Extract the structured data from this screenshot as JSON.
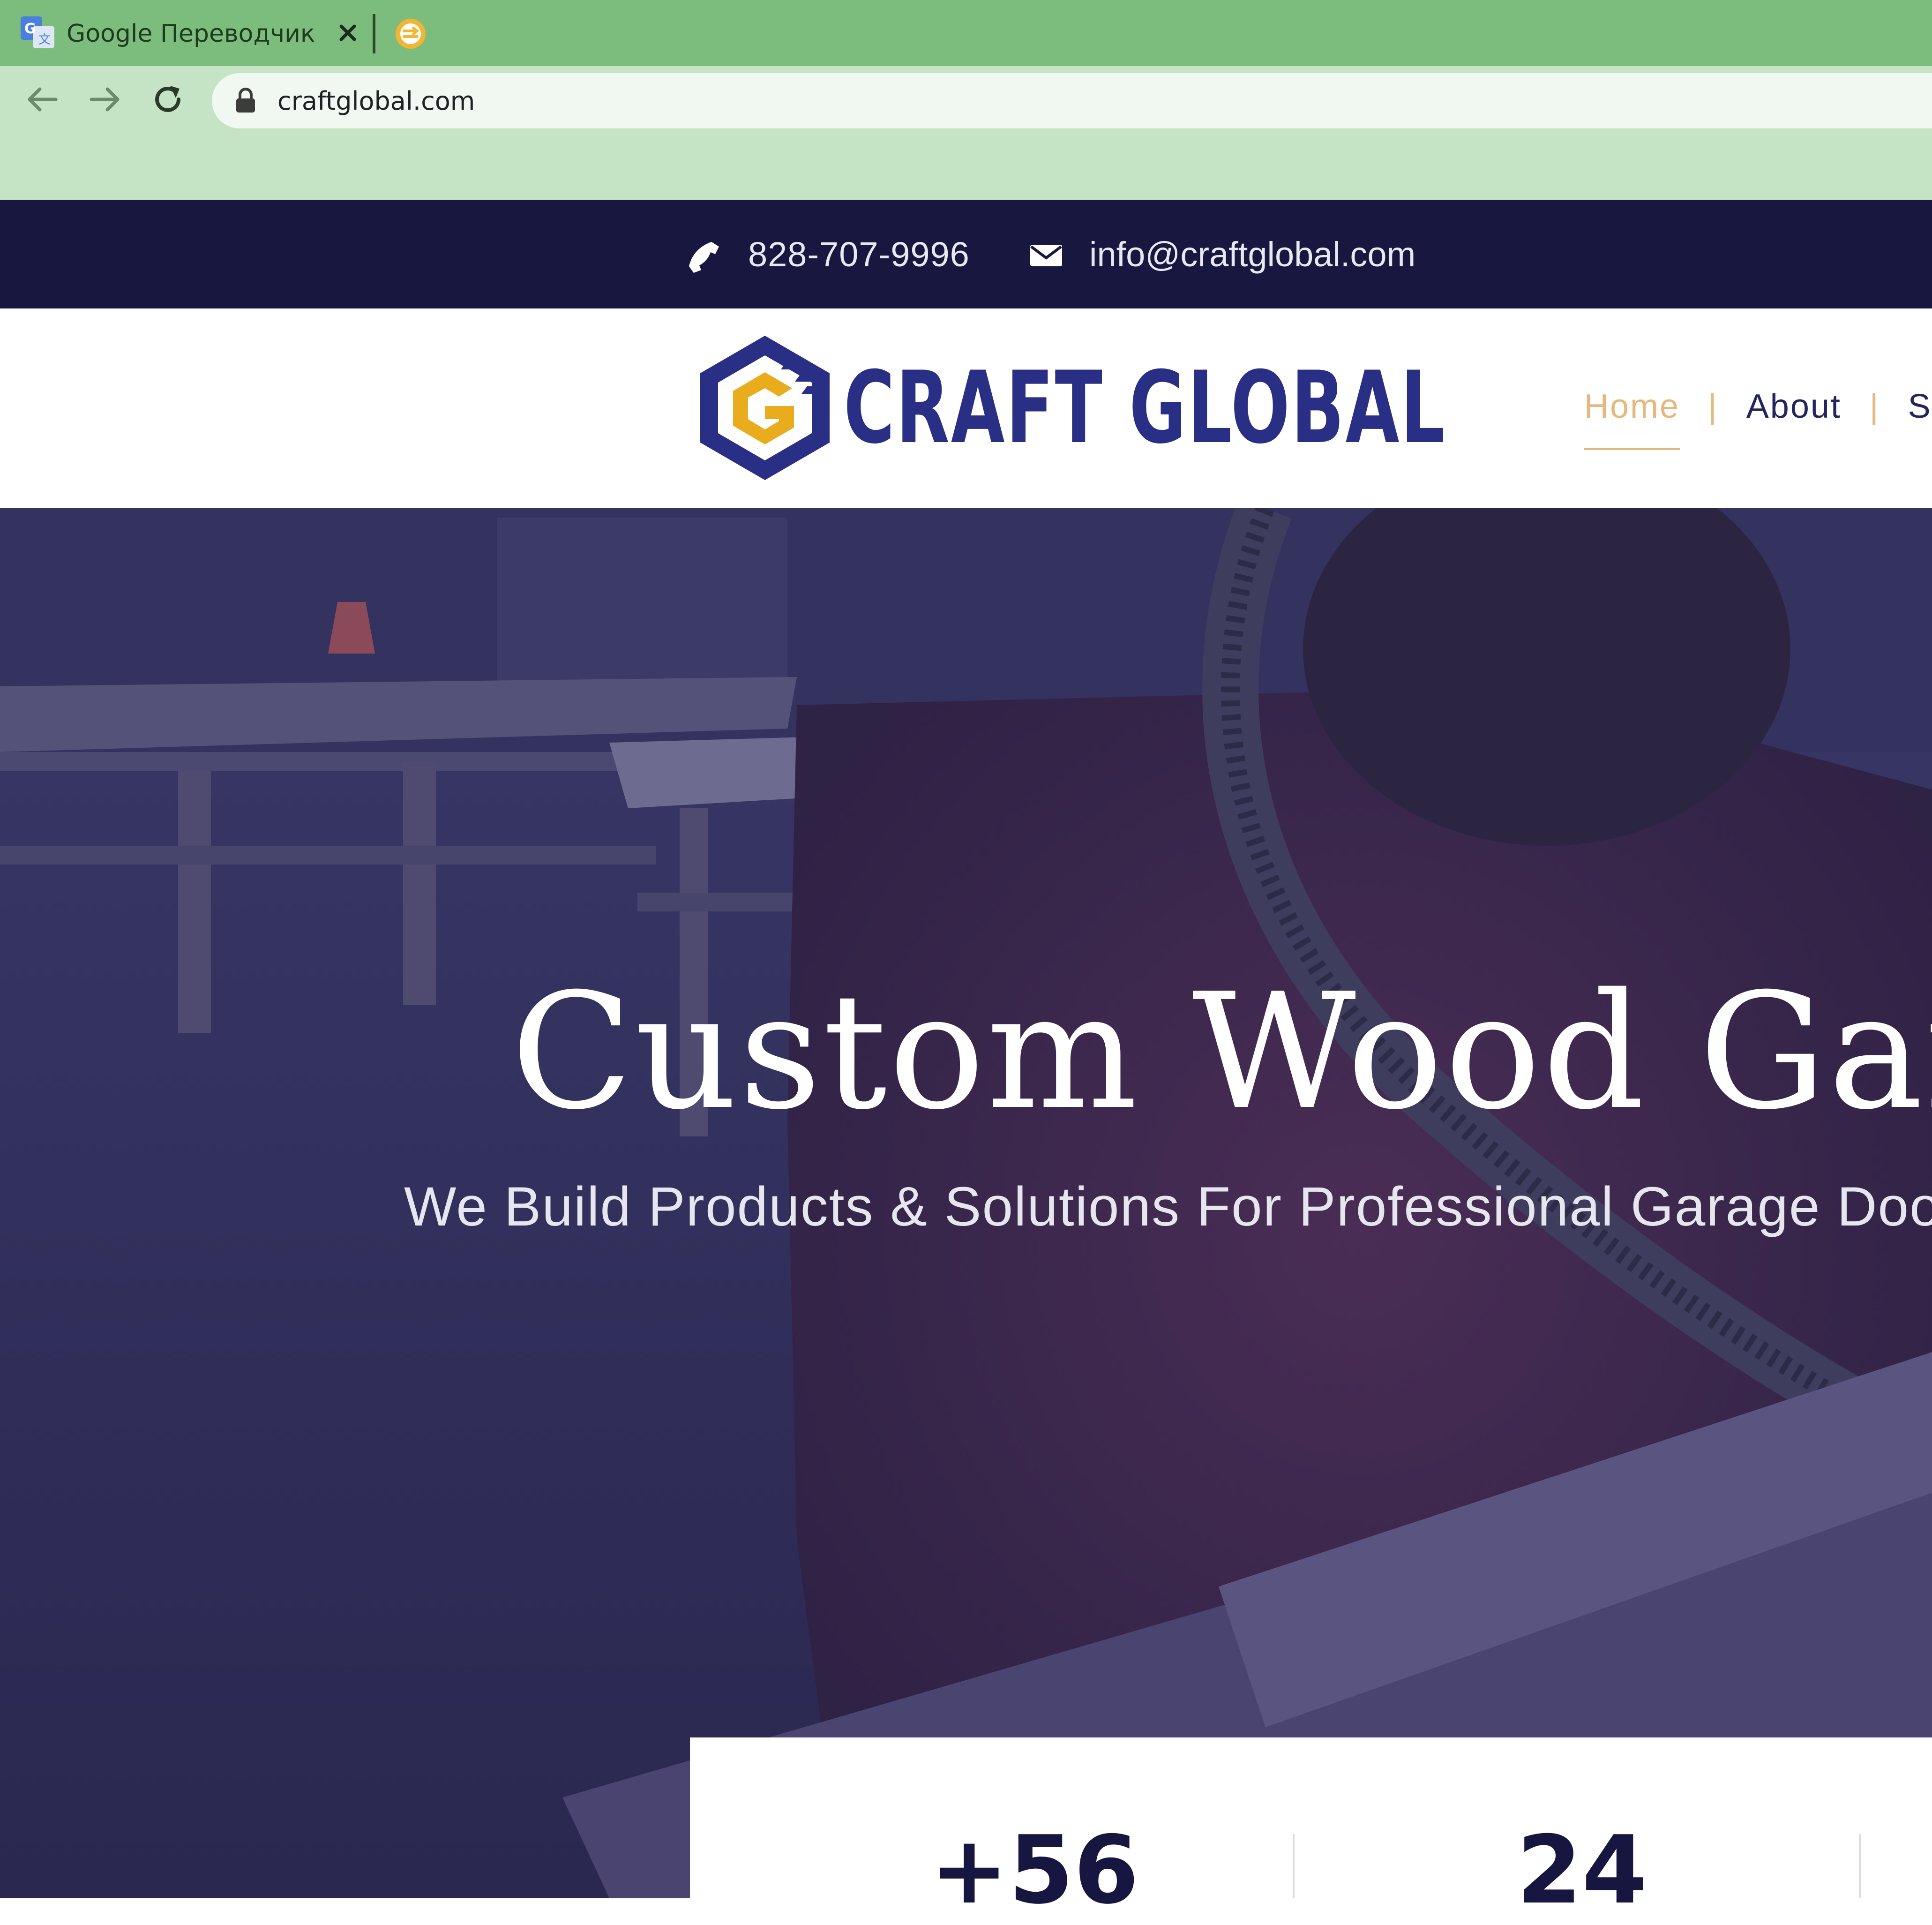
{
  "browser": {
    "tab_title": "Google Переводчик",
    "url": "craftglobal.com"
  },
  "contact": {
    "phone": "828-707-9996",
    "email": "info@craftglobal.com"
  },
  "header": {
    "logo_text": "CRAFT GLOBAL",
    "nav": [
      {
        "label": "Home",
        "active": true
      },
      {
        "label": "About",
        "active": false
      },
      {
        "label": "S",
        "active": false
      }
    ]
  },
  "hero": {
    "title": "Custom Wood Garag",
    "subtitle": "We Build Products & Solutions For Professional Garage Doo"
  },
  "stats": [
    {
      "value": "+56"
    },
    {
      "value": "24"
    }
  ],
  "colors": {
    "tabstrip": "#7cbc7c",
    "toolbar": "#c5e3c5",
    "topbar": "#181740",
    "brand_blue": "#2a2f86",
    "brand_gold": "#e9ac1c",
    "nav_active": "#e7b87d",
    "hero_overlay": "#2b2a55"
  }
}
